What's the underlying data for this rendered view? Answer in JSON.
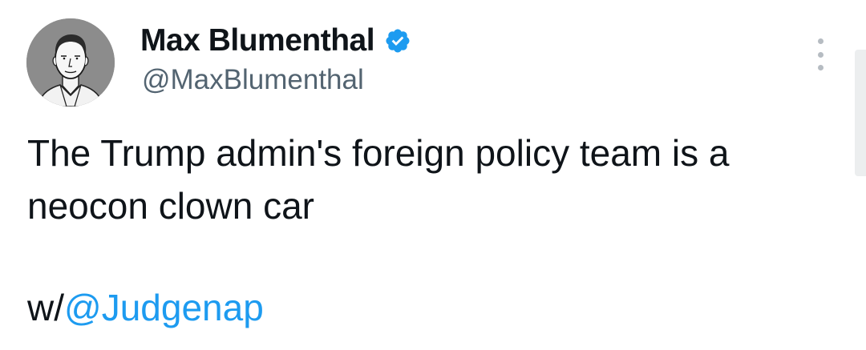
{
  "author": {
    "display_name": "Max Blumenthal",
    "handle": "@MaxBlumenthal",
    "verified": true,
    "avatar_icon": "avatar-sketch-portrait",
    "verified_icon": "verified-check-icon"
  },
  "tweet": {
    "line1": "The Trump admin's foreign policy team is a",
    "line2": "neocon clown car",
    "line3_prefix": "w/",
    "mention": "@Judgenap"
  },
  "menu": {
    "icon": "more-vertical-icon"
  },
  "colors": {
    "text": "#0f1419",
    "secondary": "#536471",
    "link": "#1d9bf0",
    "badge": "#1d9bf0"
  }
}
